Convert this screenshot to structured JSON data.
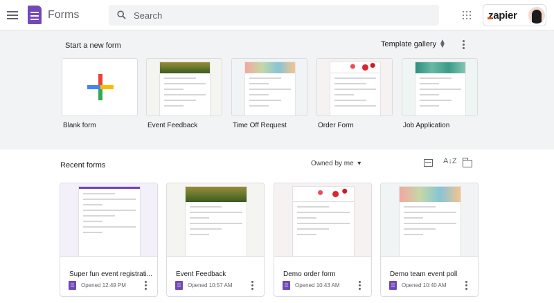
{
  "header": {
    "app_title": "Forms",
    "search_placeholder": "Search",
    "account_brand": "zapier"
  },
  "templates": {
    "section_title": "Start a new form",
    "gallery_label": "Template gallery",
    "items": [
      {
        "label": "Blank form"
      },
      {
        "label": "Event Feedback"
      },
      {
        "label": "Time Off Request"
      },
      {
        "label": "Order Form"
      },
      {
        "label": "Job Application"
      }
    ]
  },
  "recent": {
    "section_title": "Recent forms",
    "owner_filter": "Owned by me",
    "sort_glyph": "A↓Z",
    "cards": [
      {
        "title": "Super fun event registrati...",
        "opened": "Opened 12:49 PM"
      },
      {
        "title": "Event Feedback",
        "opened": "Opened 10:57 AM"
      },
      {
        "title": "Demo order form",
        "opened": "Opened 10:43 AM"
      },
      {
        "title": "Demo team event poll",
        "opened": "Opened 10:40 AM"
      }
    ]
  },
  "icons": {
    "menu": "hamburger-menu-icon",
    "search": "magnifier-icon",
    "apps": "grid-apps-icon",
    "more": "vertical-dots-icon",
    "list_view": "list-view-icon",
    "sort": "sort-az-icon",
    "folder": "folder-icon"
  },
  "colors": {
    "forms_purple": "#7248b9",
    "band_bg": "#f1f3f4",
    "plus_red": "#ea4335",
    "plus_blue": "#4285f4",
    "plus_yellow": "#fbbc05",
    "plus_green": "#34a853"
  }
}
